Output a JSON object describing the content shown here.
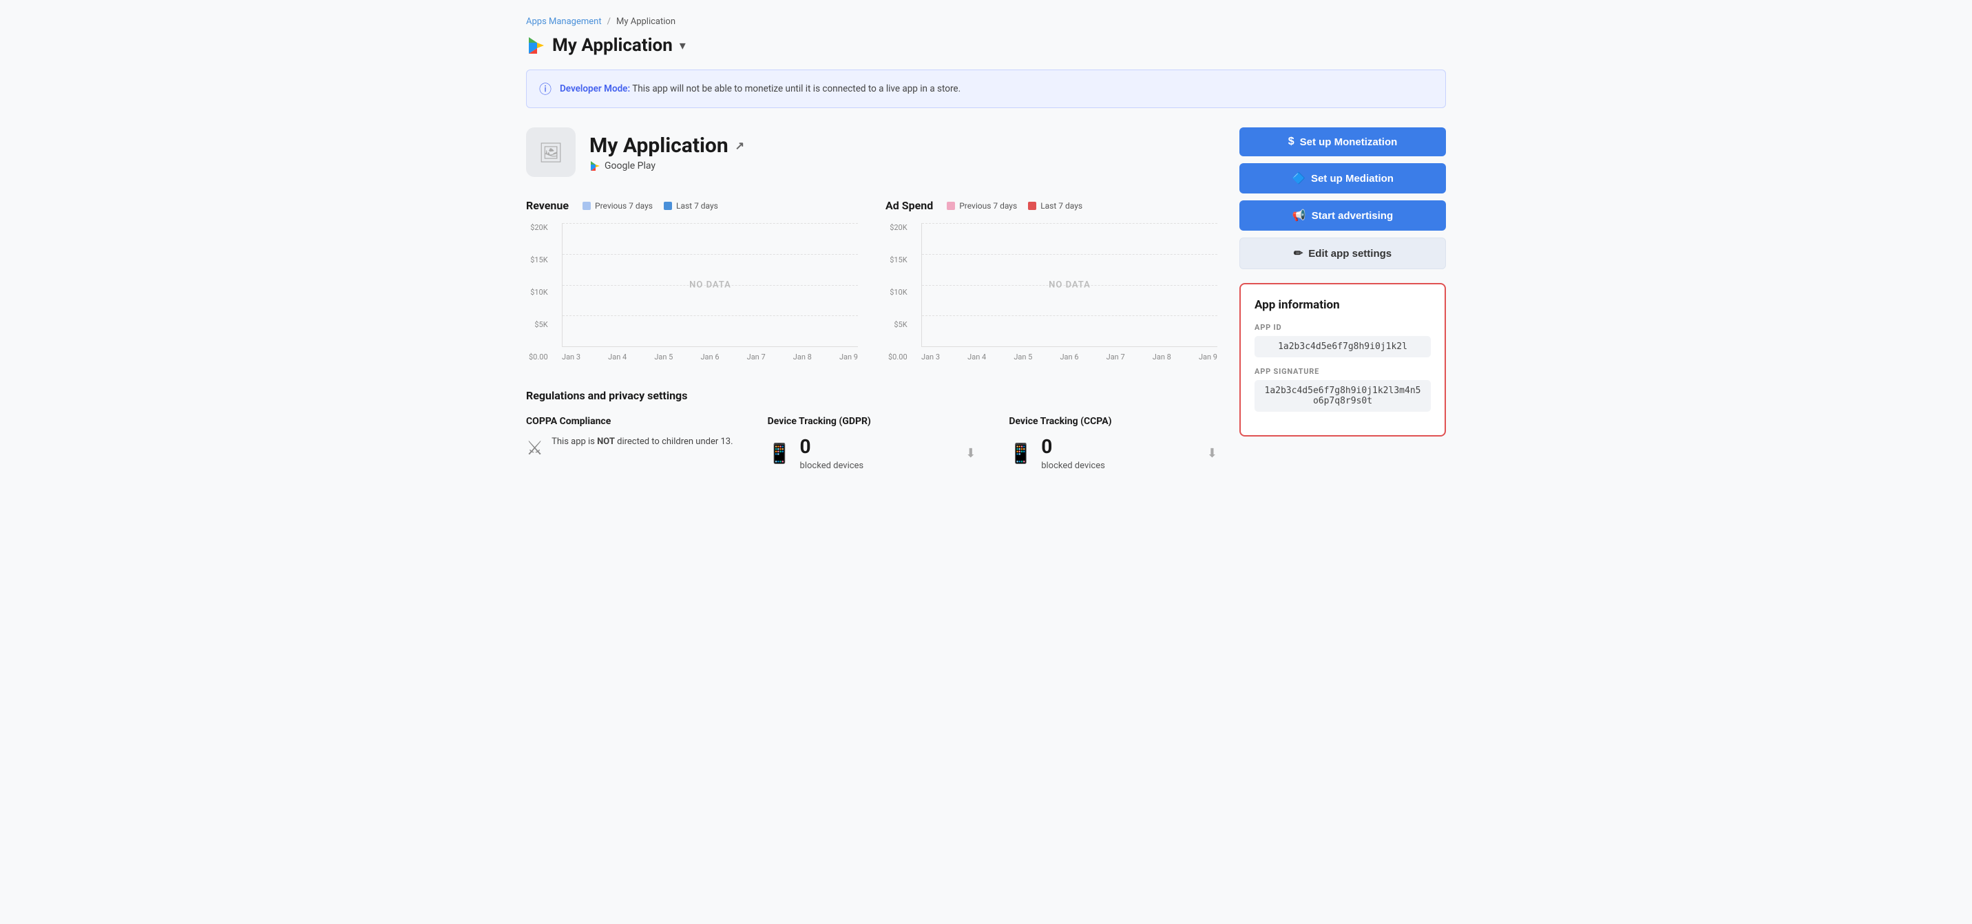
{
  "breadcrumb": {
    "parent": "Apps Management",
    "separator": "/",
    "current": "My Application"
  },
  "header": {
    "app_title": "My Application",
    "dropdown_arrow": "▾"
  },
  "dev_banner": {
    "icon": "ℹ",
    "bold_text": "Developer Mode:",
    "message": " This app will not be able to monetize until it is connected to a live app in a store."
  },
  "app_card": {
    "name": "My Application",
    "store": "Google Play",
    "external_link": "↗"
  },
  "revenue_chart": {
    "title": "Revenue",
    "legend_prev_label": "Previous 7 days",
    "legend_last_label": "Last 7 days",
    "legend_prev_color": "#a8c4f0",
    "legend_last_color": "#4a90d9",
    "no_data": "NO DATA",
    "y_labels": [
      "$20K",
      "$15K",
      "$10K",
      "$5K",
      "$0.00"
    ],
    "x_labels": [
      "Jan 3",
      "Jan 4",
      "Jan 5",
      "Jan 6",
      "Jan 7",
      "Jan 8",
      "Jan 9"
    ]
  },
  "adspend_chart": {
    "title": "Ad Spend",
    "legend_prev_label": "Previous 7 days",
    "legend_last_label": "Last 7 days",
    "legend_prev_color": "#f0a8c0",
    "legend_last_color": "#e05252",
    "no_data": "NO DATA",
    "y_labels": [
      "$20K",
      "$15K",
      "$10K",
      "$5K",
      "$0.00"
    ],
    "x_labels": [
      "Jan 3",
      "Jan 4",
      "Jan 5",
      "Jan 6",
      "Jan 7",
      "Jan 8",
      "Jan 9"
    ]
  },
  "buttons": {
    "monetization_label": "Set up Monetization",
    "mediation_label": "Set up Mediation",
    "advertising_label": "Start advertising",
    "edit_label": "Edit app settings"
  },
  "app_information": {
    "title": "App information",
    "app_id_label": "APP ID",
    "app_id_value": "1a2b3c4d5e6f7g8h9i0j1k2l",
    "app_sig_label": "APP SIGNATURE",
    "app_sig_value": "1a2b3c4d5e6f7g8h9i0j1k2l3m4n5o6p7q8r9s0t"
  },
  "regulations": {
    "title": "Regulations and privacy settings",
    "coppa": {
      "title": "COPPA Compliance",
      "text_before_bold": "This app is ",
      "bold": "NOT",
      "text_after": " directed to children under 13."
    },
    "gdpr": {
      "title": "Device Tracking (GDPR)",
      "count": "0",
      "label": "blocked devices"
    },
    "ccpa": {
      "title": "Device Tracking (CCPA)",
      "count": "0",
      "label": "blocked devices"
    }
  }
}
